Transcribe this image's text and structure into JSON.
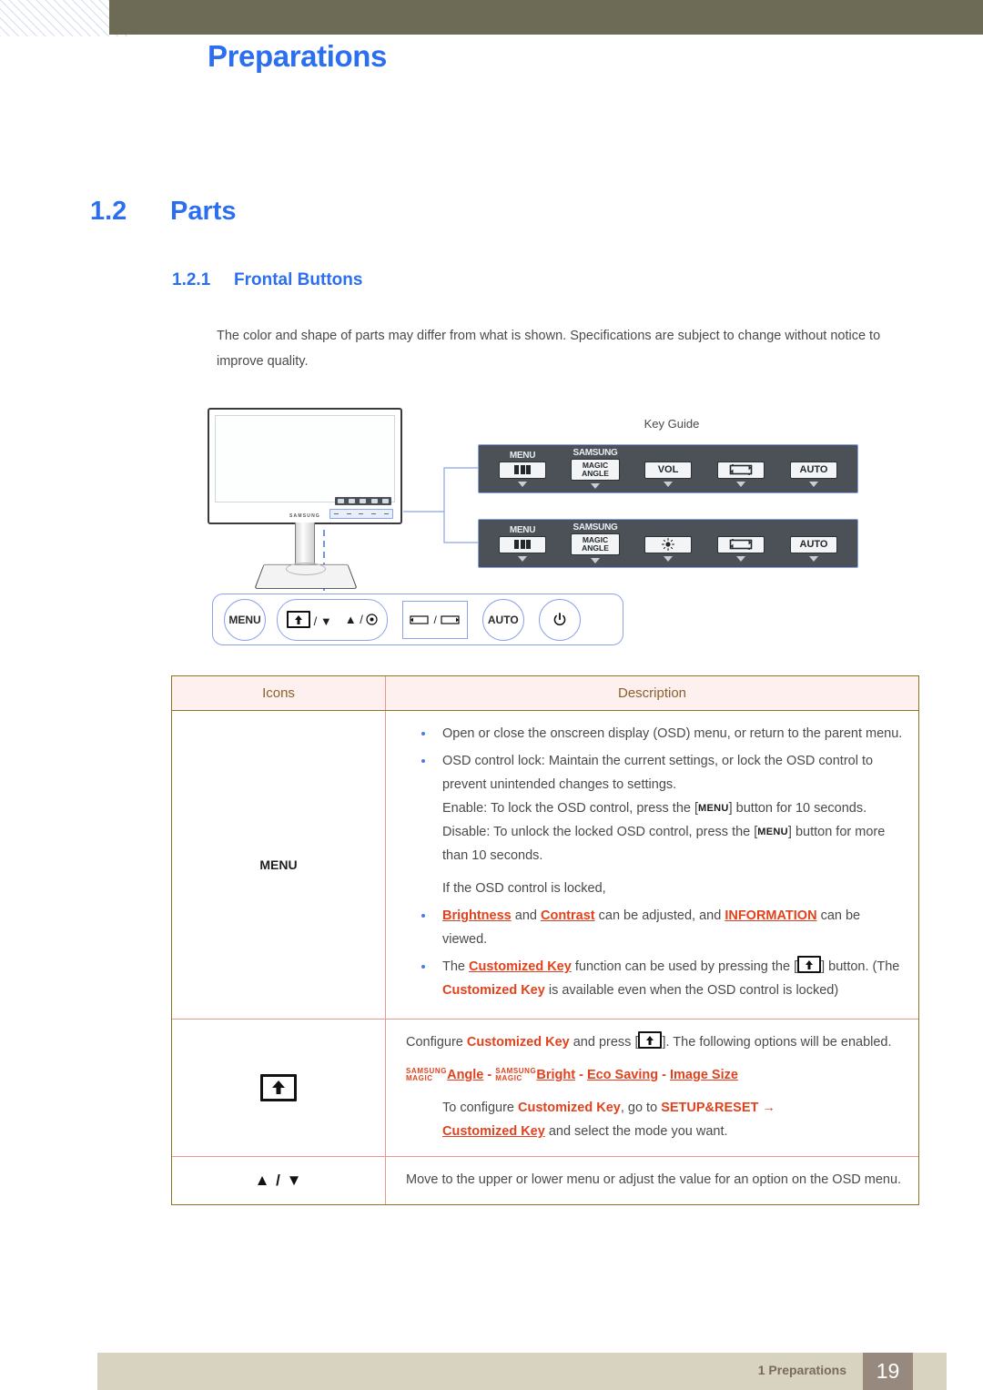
{
  "header": {
    "chapter_title": "Preparations"
  },
  "headings": {
    "h1_num": "1.2",
    "h1_text": "Parts",
    "h2_num": "1.2.1",
    "h2_text": "Frontal Buttons"
  },
  "intro": "The color and shape of parts may differ from what is shown. Specifications are subject to change without notice to improve quality.",
  "figure": {
    "key_guide_label": "Key Guide",
    "monitor_brand": "SAMSUNG",
    "panels": [
      {
        "cells": [
          {
            "top": "MENU",
            "icon": "menu-bars-icon",
            "label": ""
          },
          {
            "top": "SAMSUNG",
            "icon": "magic-angle-box",
            "label_line1": "MAGIC",
            "label_line2": "ANGLE"
          },
          {
            "top": "",
            "icon": "vol-box",
            "label": "VOL"
          },
          {
            "top": "",
            "icon": "source-box",
            "label": ""
          },
          {
            "top": "",
            "icon": "auto-box",
            "label": "AUTO"
          }
        ]
      },
      {
        "cells": [
          {
            "top": "MENU",
            "icon": "menu-bars-icon",
            "label": ""
          },
          {
            "top": "SAMSUNG",
            "icon": "magic-angle-box",
            "label_line1": "MAGIC",
            "label_line2": "ANGLE"
          },
          {
            "top": "",
            "icon": "brightness-box",
            "label": ""
          },
          {
            "top": "",
            "icon": "source-box",
            "label": ""
          },
          {
            "top": "",
            "icon": "auto-box",
            "label": "AUTO"
          }
        ]
      }
    ],
    "front_buttons": {
      "menu": "MENU",
      "pill_left": "/ ▼",
      "pill_right": "▲ /",
      "auto": "AUTO",
      "power": "⏻"
    }
  },
  "table": {
    "headers": {
      "icons": "Icons",
      "description": "Description"
    },
    "rows": [
      {
        "icon_label": "MENU",
        "icon_type": "text",
        "bullets": [
          "Open or close the onscreen display (OSD) menu, or return to the parent menu."
        ],
        "bullet2_lead": "OSD control lock: Maintain the current settings, or lock the OSD control to prevent unintended changes to settings.",
        "enable_pre": "Enable: To lock the OSD control, press the [",
        "enable_key": "MENU",
        "enable_post": "] button for 10 seconds.",
        "disable_pre": "Disable: To unlock the locked OSD control, press the [",
        "disable_key": "MENU",
        "disable_post": "] button for more than 10 seconds.",
        "locked_note": "If the OSD control is locked,",
        "sub_bullet1": {
          "a": "Brightness",
          "b": " and ",
          "c": "Contrast",
          "d": " can be adjusted, and ",
          "e": "INFORMATION",
          "f": " can be viewed."
        },
        "sub_bullet2": {
          "a": "The ",
          "b": "Customized Key",
          "c": " function can be used by pressing the [",
          "d": "] button. (The ",
          "e": "Customized Key",
          "f": " is available even when the OSD control is locked)"
        }
      },
      {
        "icon_label": "",
        "icon_type": "up-arrow-box",
        "line1_a": "Configure ",
        "line1_b": "Customized Key",
        "line1_c": " and press [",
        "line1_d": "]. The following options will be enabled.",
        "options": {
          "magic_top": "SAMSUNG",
          "magic_bottom": "MAGIC",
          "opt1": "Angle",
          "sep1": " - ",
          "opt2": "Bright",
          "sep2": " - ",
          "opt3": "Eco Saving",
          "sep3": " - ",
          "opt4": "Image Size"
        },
        "note": {
          "a": "To configure ",
          "b": "Customized Key",
          "c": ", go to ",
          "d": "SETUP&RESET",
          "e": "  →  ",
          "f": "Customized Key",
          "g": " and select the mode you want."
        }
      },
      {
        "icon_label": "▲ / ▼",
        "icon_type": "updown",
        "text": "Move to the upper or lower menu or adjust the value for an option on the OSD menu."
      }
    ]
  },
  "footer": {
    "label": "1 Preparations",
    "page": "19"
  },
  "colors": {
    "accent_blue": "#2b6ef0",
    "olive": "#6d6b56",
    "table_border": "#8a7426",
    "table_header_bg": "#fdf0ef",
    "table_header_text": "#8a5f2b",
    "highlight_orange": "#e1421d",
    "footer_bar": "#d8d2c0",
    "footer_page_box": "#97897e"
  }
}
